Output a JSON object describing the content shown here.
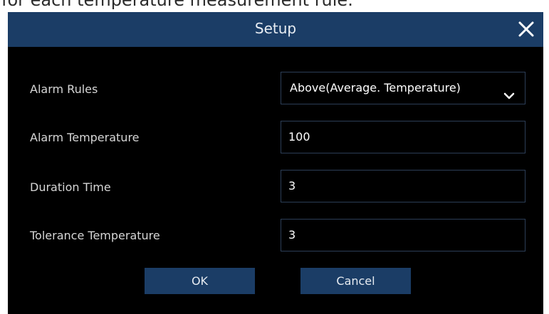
{
  "caption": "for each temperature measurement rule.",
  "dialog": {
    "title": "Setup",
    "close_icon": "close-icon"
  },
  "form": {
    "alarm_rules": {
      "label": "Alarm Rules",
      "value": "Above(Average. Temperature)",
      "icon": "chevron-down-icon"
    },
    "alarm_temperature": {
      "label": "Alarm Temperature",
      "value": "100"
    },
    "duration_time": {
      "label": "Duration Time",
      "value": "3"
    },
    "tolerance_temperature": {
      "label": "Tolerance Temperature",
      "value": "3"
    }
  },
  "buttons": {
    "ok": "OK",
    "cancel": "Cancel"
  },
  "colors": {
    "titlebar": "#1b3d66",
    "background": "#000000",
    "field_border": "#2c3e57",
    "button": "#1b3d66"
  }
}
